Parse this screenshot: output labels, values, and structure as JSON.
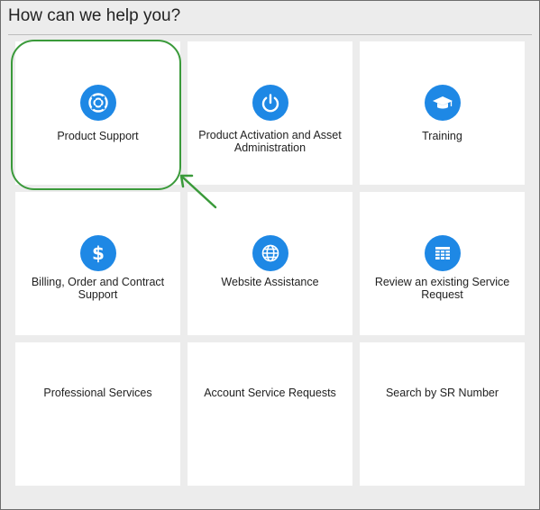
{
  "heading": "How can we help you?",
  "accent_color": "#1e88e5",
  "highlight_color": "#3a9a3a",
  "tiles": [
    {
      "label": "Product Support",
      "icon": "lifebuoy-icon"
    },
    {
      "label": "Product Activation and Asset Administration",
      "icon": "power-icon"
    },
    {
      "label": "Training",
      "icon": "graduation-cap-icon"
    },
    {
      "label": "Billing, Order and Contract Support",
      "icon": "dollar-icon"
    },
    {
      "label": "Website Assistance",
      "icon": "globe-icon"
    },
    {
      "label": "Review an existing Service Request",
      "icon": "table-icon"
    },
    {
      "label": "Professional Services"
    },
    {
      "label": "Account Service Requests"
    },
    {
      "label": "Search by SR Number"
    }
  ]
}
